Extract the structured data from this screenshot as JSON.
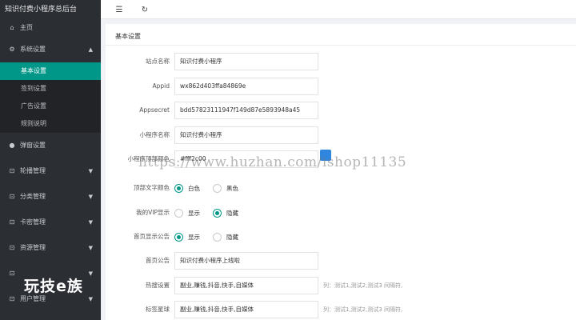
{
  "app": {
    "title": "知识付费小程序总后台"
  },
  "sidebar": {
    "items": [
      {
        "label": "主页",
        "icon": "home-icon"
      },
      {
        "label": "系统设置",
        "icon": "gear-icon",
        "expanded": true,
        "children": [
          {
            "label": "基本设置",
            "active": true
          },
          {
            "label": "签到设置"
          },
          {
            "label": "广告设置"
          },
          {
            "label": "规则说明"
          }
        ]
      },
      {
        "label": "弹窗设置",
        "icon": "dot-icon"
      },
      {
        "label": "轮播管理",
        "icon": "chart-icon"
      },
      {
        "label": "分类管理",
        "icon": "chart-icon"
      },
      {
        "label": "卡密管理",
        "icon": "chart-icon"
      },
      {
        "label": "资源管理",
        "icon": "chart-icon"
      },
      {
        "label": "",
        "icon": "chart-icon"
      },
      {
        "label": "用户管理",
        "icon": "chart-icon"
      }
    ],
    "logo_text": "玩技e族"
  },
  "toolbar": {
    "menu_icon": "menu-toggle-icon",
    "refresh_icon": "refresh-icon"
  },
  "panel": {
    "title": "基本设置",
    "fields": {
      "site_name": {
        "label": "站点名称",
        "value": "知识付费小程序"
      },
      "appid": {
        "label": "Appid",
        "value": "wx862d403ffa84869e"
      },
      "appsecret": {
        "label": "Appsecret",
        "value": "bdd57823111947f149d87e5893948a45"
      },
      "mini_name": {
        "label": "小程序名称",
        "value": "知识付费小程序"
      },
      "top_color": {
        "label": "小程序顶部颜色",
        "value": "#fff2c00"
      },
      "top_text_color": {
        "label": "顶部文字颜色",
        "options": [
          "白色",
          "黑色"
        ],
        "selected": "白色"
      },
      "vip_display": {
        "label": "我的VIP显示",
        "options": [
          "显示",
          "隐藏"
        ],
        "selected": "隐藏"
      },
      "home_notice_display": {
        "label": "首页显示公告",
        "options": [
          "显示",
          "隐藏"
        ],
        "selected": "显示"
      },
      "home_notice": {
        "label": "首页公告",
        "value": "知识付费小程序上线啦"
      },
      "hot_search": {
        "label": "热搜设置",
        "value": "副业,赚钱,抖音,快手,自媒体",
        "hint": "列：测试1,测试2,测试3 间隔符,"
      },
      "tag_cloud": {
        "label": "标签星球",
        "value": "副业,赚钱,抖音,快手,自媒体",
        "hint": "列：测试1,测试2,测试3 间隔符,"
      }
    }
  },
  "watermark": "https://www.huzhan.com/ishop11135",
  "colors": {
    "accent": "#009688",
    "sidebar_bg": "#2b2e33",
    "swatch": "#2e86de"
  }
}
